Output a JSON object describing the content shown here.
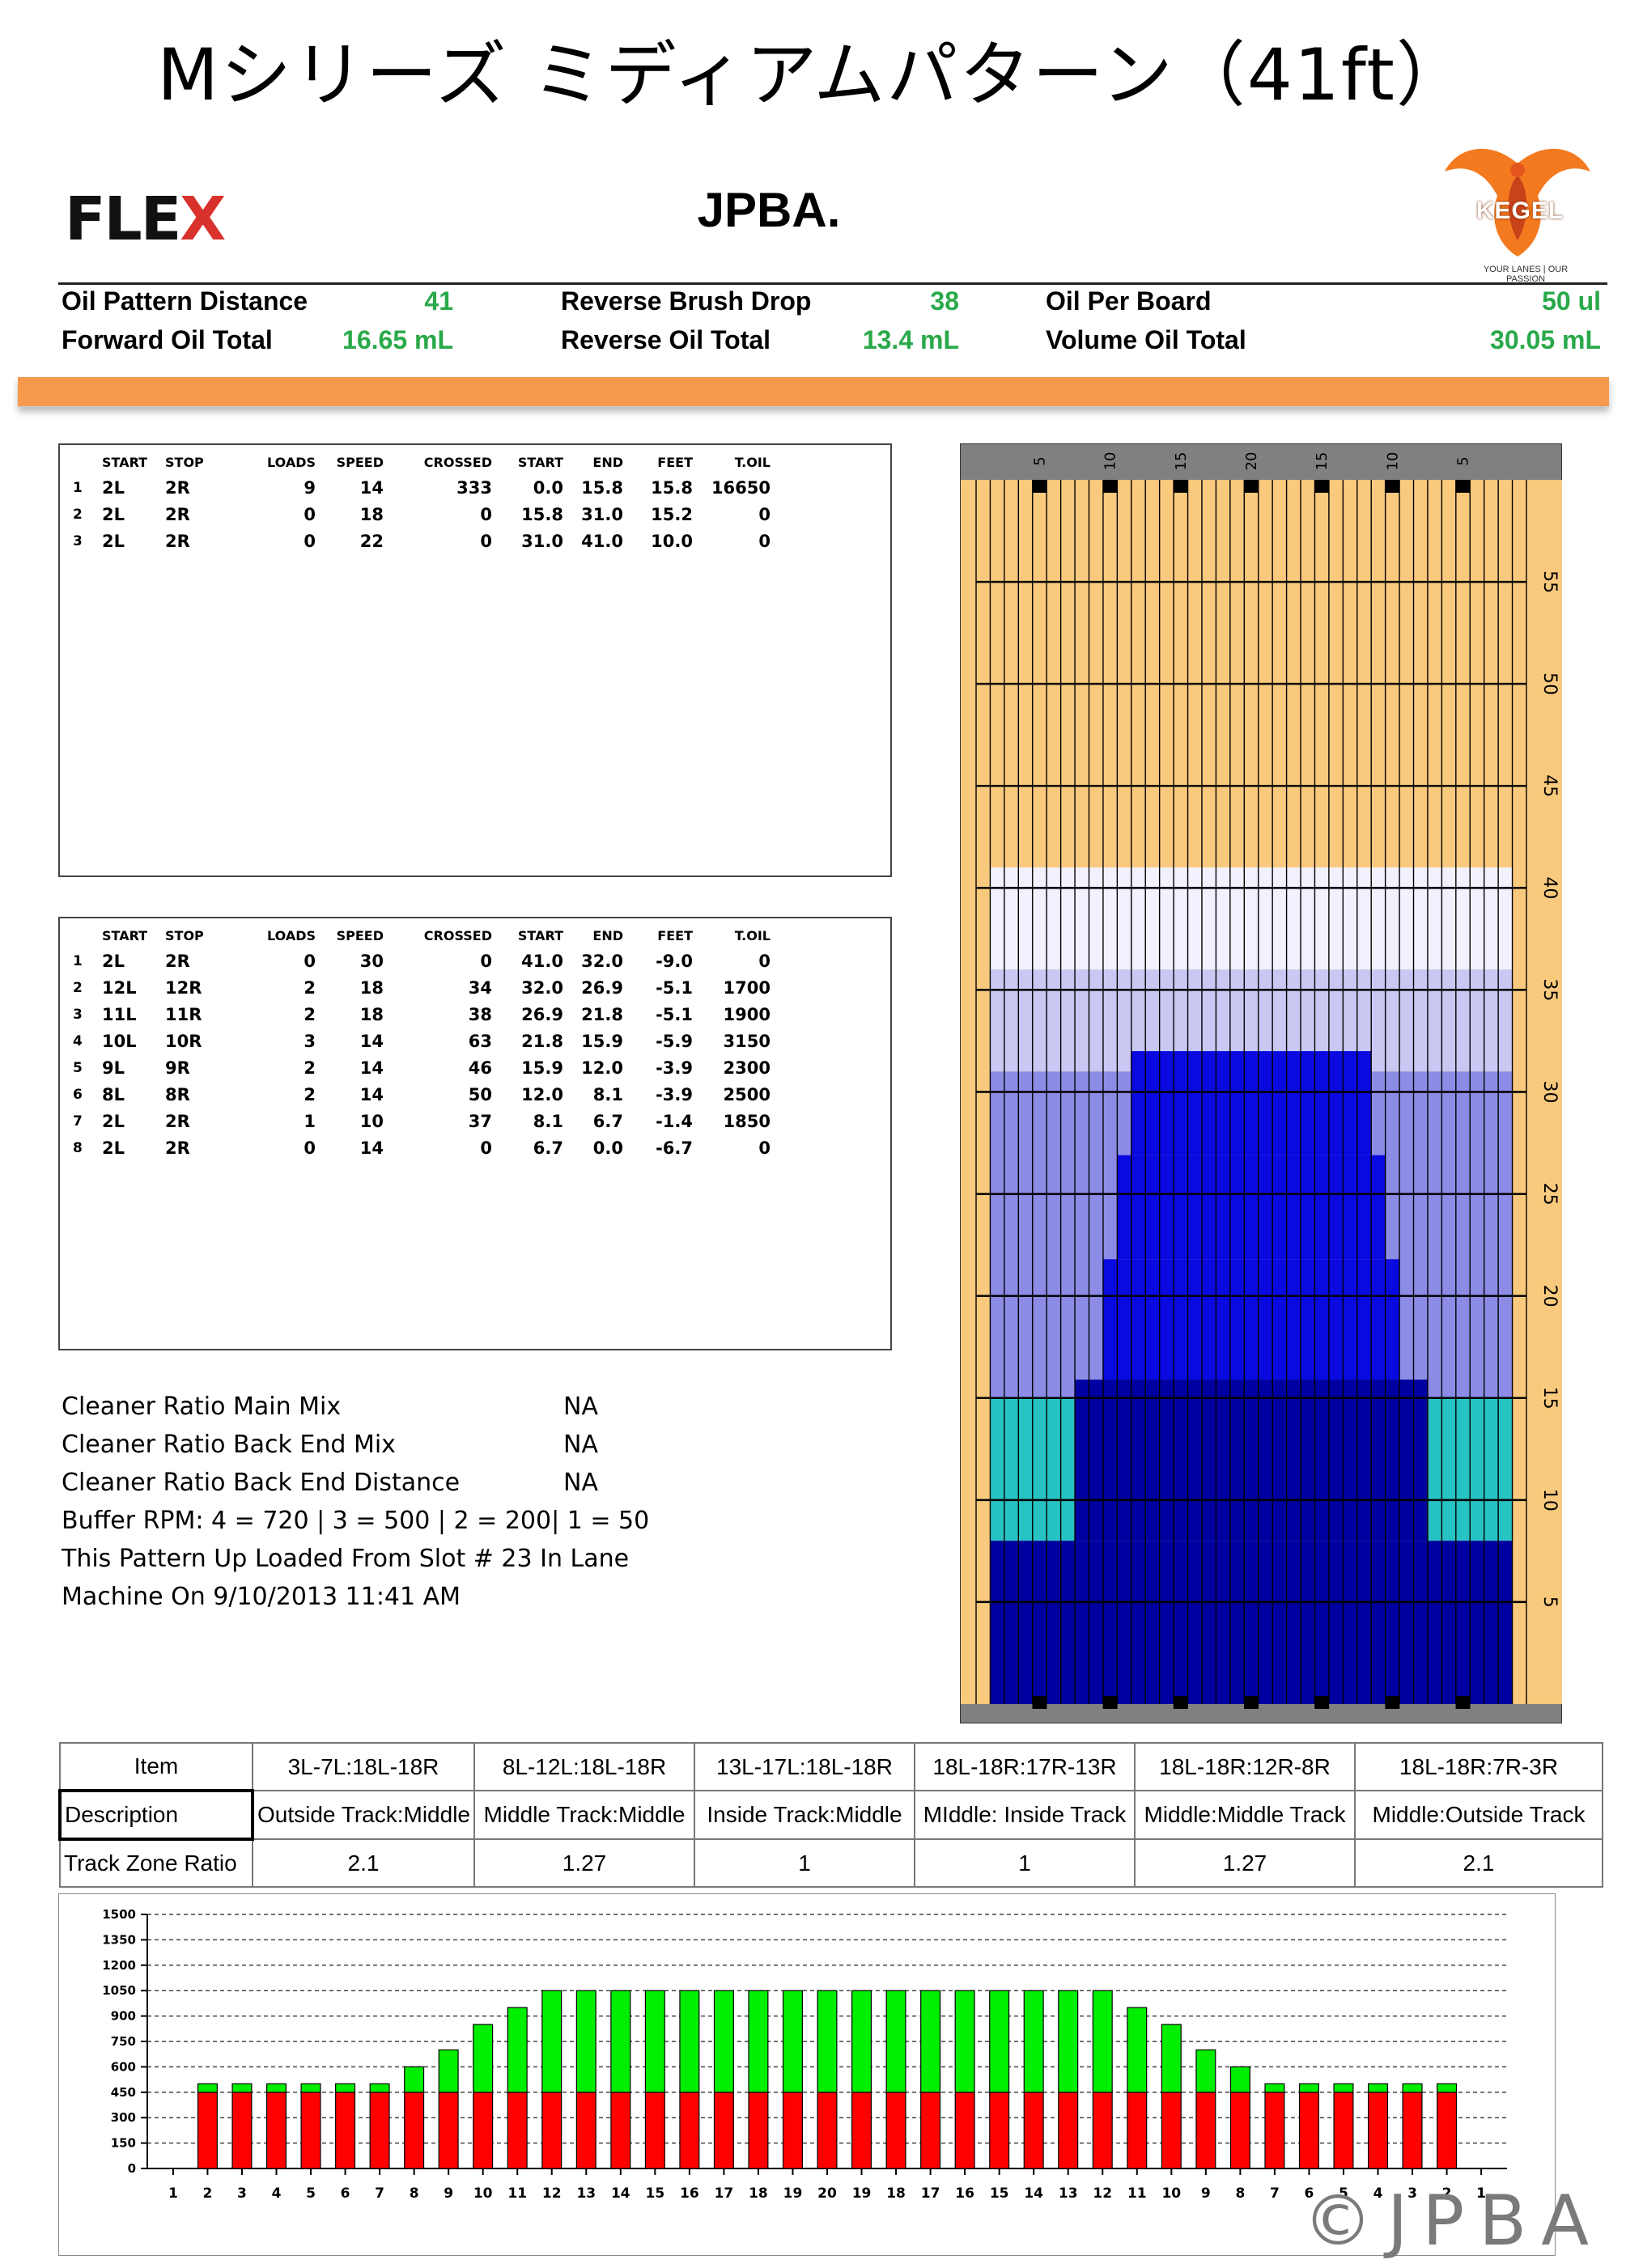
{
  "title": "Mシリーズ ミディアムパターン（41ft）",
  "header": {
    "brand_left": "FLE",
    "brand_left_x": "X",
    "center_title": "JPBA.",
    "brand_right": "KEGEL",
    "brand_right_tagline": "YOUR LANES | OUR PASSION",
    "accent_color": "#f59a4c"
  },
  "stats": [
    {
      "label": "Oil Pattern Distance",
      "value": "41"
    },
    {
      "label": "Reverse Brush Drop",
      "value": "38"
    },
    {
      "label": "Oil Per Board",
      "value": "50 ul"
    },
    {
      "label": "Forward Oil Total",
      "value": "16.65 mL"
    },
    {
      "label": "Reverse Oil Total",
      "value": "13.4 mL"
    },
    {
      "label": "Volume Oil Total",
      "value": "30.05 mL"
    }
  ],
  "forward_table": {
    "headers": [
      "",
      "START",
      "STOP",
      "LOADS",
      "SPEED",
      "CROSSED",
      "START",
      "END",
      "FEET",
      "T.OIL"
    ],
    "rows": [
      [
        "1",
        "2L",
        "2R",
        "9",
        "14",
        "333",
        "0.0",
        "15.8",
        "15.8",
        "16650"
      ],
      [
        "2",
        "2L",
        "2R",
        "0",
        "18",
        "0",
        "15.8",
        "31.0",
        "15.2",
        "0"
      ],
      [
        "3",
        "2L",
        "2R",
        "0",
        "22",
        "0",
        "31.0",
        "41.0",
        "10.0",
        "0"
      ]
    ]
  },
  "reverse_table": {
    "headers": [
      "",
      "START",
      "STOP",
      "LOADS",
      "SPEED",
      "CROSSED",
      "START",
      "END",
      "FEET",
      "T.OIL"
    ],
    "rows": [
      [
        "1",
        "2L",
        "2R",
        "0",
        "30",
        "0",
        "41.0",
        "32.0",
        "-9.0",
        "0"
      ],
      [
        "2",
        "12L",
        "12R",
        "2",
        "18",
        "34",
        "32.0",
        "26.9",
        "-5.1",
        "1700"
      ],
      [
        "3",
        "11L",
        "11R",
        "2",
        "18",
        "38",
        "26.9",
        "21.8",
        "-5.1",
        "1900"
      ],
      [
        "4",
        "10L",
        "10R",
        "3",
        "14",
        "63",
        "21.8",
        "15.9",
        "-5.9",
        "3150"
      ],
      [
        "5",
        "9L",
        "9R",
        "2",
        "14",
        "46",
        "15.9",
        "12.0",
        "-3.9",
        "2300"
      ],
      [
        "6",
        "8L",
        "8R",
        "2",
        "14",
        "50",
        "12.0",
        "8.1",
        "-3.9",
        "2500"
      ],
      [
        "7",
        "2L",
        "2R",
        "1",
        "10",
        "37",
        "8.1",
        "6.7",
        "-1.4",
        "1850"
      ],
      [
        "8",
        "2L",
        "2R",
        "0",
        "14",
        "0",
        "6.7",
        "0.0",
        "-6.7",
        "0"
      ]
    ]
  },
  "notes": [
    {
      "label": "Cleaner Ratio Main Mix",
      "value": "NA"
    },
    {
      "label": "Cleaner Ratio Back End Mix",
      "value": "NA"
    },
    {
      "label": "Cleaner Ratio Back End Distance",
      "value": "NA"
    },
    {
      "label": "Buffer RPM: 4 = 720 | 3 = 500 | 2 = 200| 1 = 50",
      "value": ""
    },
    {
      "label": "This Pattern Up Loaded From Slot # 23 In Lane",
      "value": ""
    },
    {
      "label": "Machine On 9/10/2013 11:41 AM",
      "value": ""
    }
  ],
  "ratio_table": {
    "item_label": "Item",
    "columns": [
      "3L-7L:18L-18R",
      "8L-12L:18L-18R",
      "13L-17L:18L-18R",
      "18L-18R:17R-13R",
      "18L-18R:12R-8R",
      "18L-18R:7R-3R"
    ],
    "description_label": "Description",
    "descriptions": [
      "Outside Track:Middle",
      "Middle Track:Middle",
      "Inside Track:Middle",
      "MIddle: Inside Track",
      "Middle:Middle Track",
      "Middle:Outside Track"
    ],
    "ratio_label": "Track Zone Ratio",
    "ratios": [
      "2.1",
      "1.27",
      "1",
      "1",
      "1.27",
      "2.1"
    ]
  },
  "chart_data": [
    {
      "type": "heatmap",
      "name": "lane-oil-graph",
      "top_tick_labels": [
        "5",
        "10",
        "15",
        "20",
        "15",
        "10",
        "5"
      ],
      "right_tick_labels": [
        "5",
        "10",
        "15",
        "20",
        "25",
        "30",
        "35",
        "40",
        "45",
        "50",
        "55"
      ],
      "ylim": [
        0,
        60
      ],
      "boards": 39,
      "colors": {
        "dry": "#f9c97d",
        "lightest": "#f2f2ff",
        "light": "#c8c8f2",
        "medium": "#8c8ce6",
        "teal": "#27c2c2",
        "blue": "#0a0ae0",
        "dark": "#0000a0"
      },
      "zones": [
        {
          "boards": [
            1,
            39
          ],
          "from": 41,
          "to": 60,
          "color": "dry"
        },
        {
          "boards": [
            2,
            38
          ],
          "from": 36,
          "to": 41,
          "color": "lightest"
        },
        {
          "boards": [
            2,
            38
          ],
          "from": 31,
          "to": 36,
          "color": "light"
        },
        {
          "boards": [
            2,
            38
          ],
          "from": 15,
          "to": 31,
          "color": "medium"
        },
        {
          "boards": [
            2,
            38
          ],
          "from": 8,
          "to": 15,
          "color": "teal"
        },
        {
          "boards": [
            2,
            38
          ],
          "from": 0,
          "to": 8,
          "color": "dark"
        },
        {
          "boards": [
            8,
            32
          ],
          "from": 8,
          "to": 15.9,
          "color": "dark"
        },
        {
          "boards": [
            10,
            30
          ],
          "from": 15.9,
          "to": 21.8,
          "color": "blue"
        },
        {
          "boards": [
            11,
            29
          ],
          "from": 21.8,
          "to": 26.9,
          "color": "blue"
        },
        {
          "boards": [
            12,
            28
          ],
          "from": 26.9,
          "to": 32,
          "color": "blue"
        }
      ]
    },
    {
      "type": "bar",
      "name": "board-oil-totals",
      "ylim": [
        0,
        1500
      ],
      "y_ticks": [
        0,
        150,
        300,
        450,
        600,
        750,
        900,
        1050,
        1200,
        1350,
        1500
      ],
      "categories": [
        "1",
        "2",
        "3",
        "4",
        "5",
        "6",
        "7",
        "8",
        "9",
        "10",
        "11",
        "12",
        "13",
        "14",
        "15",
        "16",
        "17",
        "18",
        "19",
        "20",
        "19",
        "18",
        "17",
        "16",
        "15",
        "14",
        "13",
        "12",
        "11",
        "10",
        "9",
        "8",
        "7",
        "6",
        "5",
        "4",
        "3",
        "2",
        "1"
      ],
      "series": [
        {
          "color": "#ff0000",
          "values": [
            0,
            450,
            450,
            450,
            450,
            450,
            450,
            450,
            450,
            450,
            450,
            450,
            450,
            450,
            450,
            450,
            450,
            450,
            450,
            450,
            450,
            450,
            450,
            450,
            450,
            450,
            450,
            450,
            450,
            450,
            450,
            450,
            450,
            450,
            450,
            450,
            450,
            450,
            0
          ]
        },
        {
          "color": "#00ee00",
          "values": [
            0,
            50,
            50,
            50,
            50,
            50,
            50,
            150,
            250,
            400,
            500,
            600,
            600,
            600,
            600,
            600,
            600,
            600,
            600,
            600,
            600,
            600,
            600,
            600,
            600,
            600,
            600,
            600,
            500,
            400,
            250,
            150,
            50,
            50,
            50,
            50,
            50,
            50,
            0
          ]
        }
      ]
    }
  ],
  "copyright": "©JPBA"
}
